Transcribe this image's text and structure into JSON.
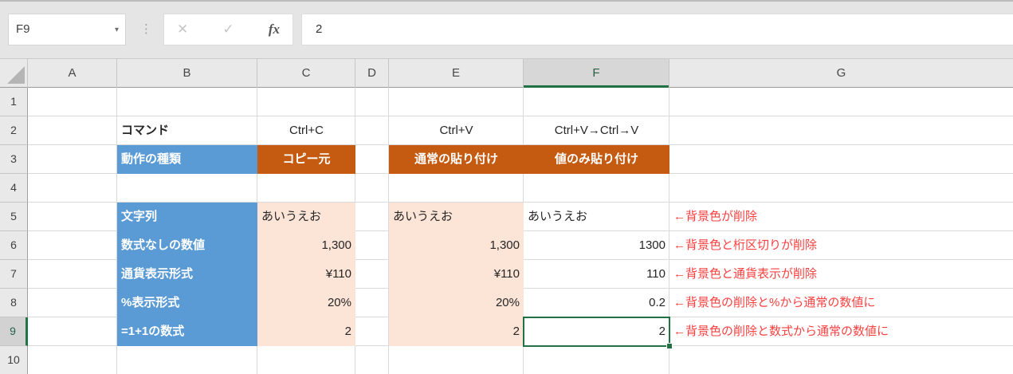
{
  "formula_bar": {
    "name_box_value": "F9",
    "dropdown_icon": "▾",
    "separator_icon": "⋮",
    "cancel_icon": "✕",
    "enter_icon": "✓",
    "fx_icon": "fx",
    "input_value": "2"
  },
  "sheet": {
    "column_headers": [
      "A",
      "B",
      "C",
      "D",
      "E",
      "F",
      "G"
    ],
    "row_numbers": [
      "1",
      "2",
      "3",
      "4",
      "5",
      "6",
      "7",
      "8",
      "9",
      "10"
    ],
    "selected_cell": "F9",
    "selected_column": "F",
    "selected_row": "9"
  },
  "cells": {
    "B2": "コマンド",
    "C2": "Ctrl+C",
    "E2": "Ctrl+V",
    "F2": "Ctrl+V→Ctrl→V",
    "B3": "動作の種類",
    "C3": "コピー元",
    "E3": "通常の貼り付け",
    "F3": "値のみ貼り付け",
    "B5": "文字列",
    "C5": "あいうえお",
    "E5": "あいうえお",
    "F5": "あいうえお",
    "G5": "←背景色が削除",
    "B6": "数式なしの数値",
    "C6": "1,300",
    "E6": "1,300",
    "F6": "1300",
    "G6": "←背景色と桁区切りが削除",
    "B7": "通貨表示形式",
    "C7": "¥110",
    "E7": "¥110",
    "F7": "110",
    "G7": "←背景色と通貨表示が削除",
    "B8": "%表示形式",
    "C8": "20%",
    "E8": "20%",
    "F8": "0.2",
    "G8": "←背景色の削除と%から通常の数値に",
    "B9": "=1+1の数式",
    "C9": "2",
    "E9": "2",
    "F9": "2",
    "G9": "←背景色の削除と数式から通常の数値に"
  },
  "colors": {
    "label_fill_blue": "#5B9BD5",
    "header_fill_orange": "#C55A11",
    "source_fill_peach": "#FCE4D6",
    "annotation_red": "#FB4040",
    "selection_green": "#217346"
  }
}
